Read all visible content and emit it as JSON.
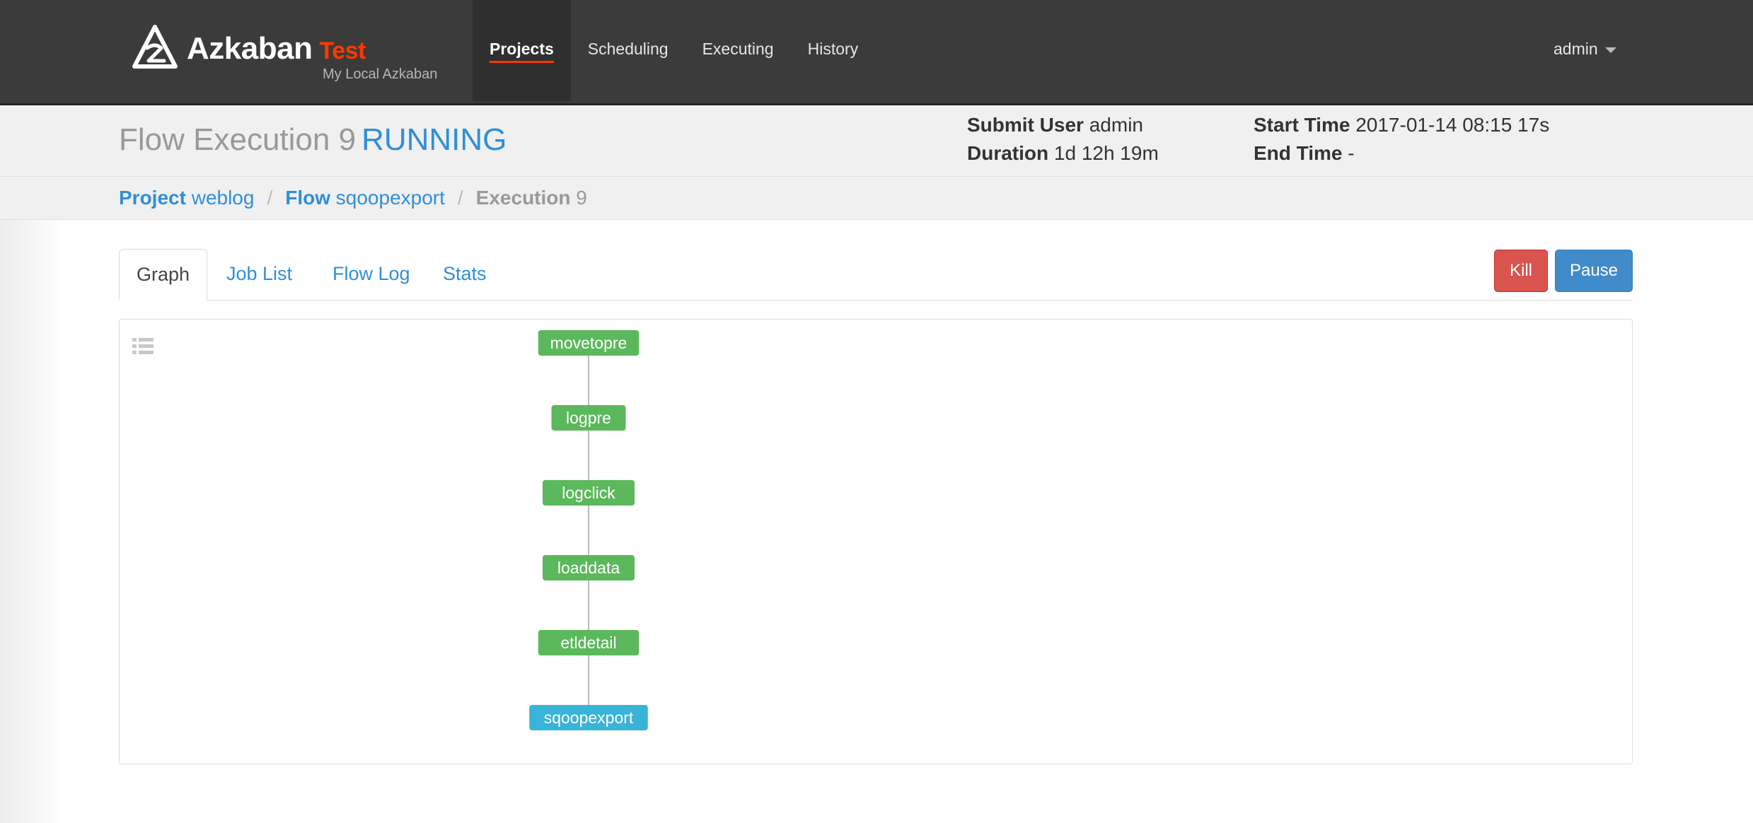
{
  "navbar": {
    "brand_name": "Azkaban",
    "brand_env": "Test",
    "brand_subtitle": "My Local Azkaban",
    "items": [
      {
        "label": "Projects",
        "active": true
      },
      {
        "label": "Scheduling",
        "active": false
      },
      {
        "label": "Executing",
        "active": false
      },
      {
        "label": "History",
        "active": false
      }
    ],
    "user": "admin"
  },
  "header": {
    "title": "Flow Execution 9",
    "status": "RUNNING",
    "submit_user_label": "Submit User",
    "submit_user": "admin",
    "duration_label": "Duration",
    "duration": "1d 12h 19m",
    "start_time_label": "Start Time",
    "start_time": "2017-01-14 08:15 17s",
    "end_time_label": "End Time",
    "end_time": "-"
  },
  "breadcrumb": {
    "project_label": "Project",
    "project": "weblog",
    "flow_label": "Flow",
    "flow": "sqoopexport",
    "execution_label": "Execution",
    "execution": "9",
    "separator": "/"
  },
  "tabs": [
    {
      "label": "Graph",
      "active": true
    },
    {
      "label": "Job List",
      "active": false
    },
    {
      "label": "Flow Log",
      "active": false
    },
    {
      "label": "Stats",
      "active": false
    }
  ],
  "actions": {
    "kill_label": "Kill",
    "pause_label": "Pause"
  },
  "graph": {
    "nodes": [
      {
        "name": "movetopre",
        "status": "succeeded"
      },
      {
        "name": "logpre",
        "status": "succeeded"
      },
      {
        "name": "logclick",
        "status": "succeeded"
      },
      {
        "name": "loaddata",
        "status": "succeeded"
      },
      {
        "name": "etldetail",
        "status": "succeeded"
      },
      {
        "name": "sqoopexport",
        "status": "running"
      }
    ],
    "status_colors": {
      "succeeded": "#5cb85c",
      "running": "#39b3d7"
    }
  },
  "colors": {
    "accent": "#ff3a00",
    "link": "#2f8fd7",
    "kill": "#d9534f",
    "pause": "#428bca"
  }
}
